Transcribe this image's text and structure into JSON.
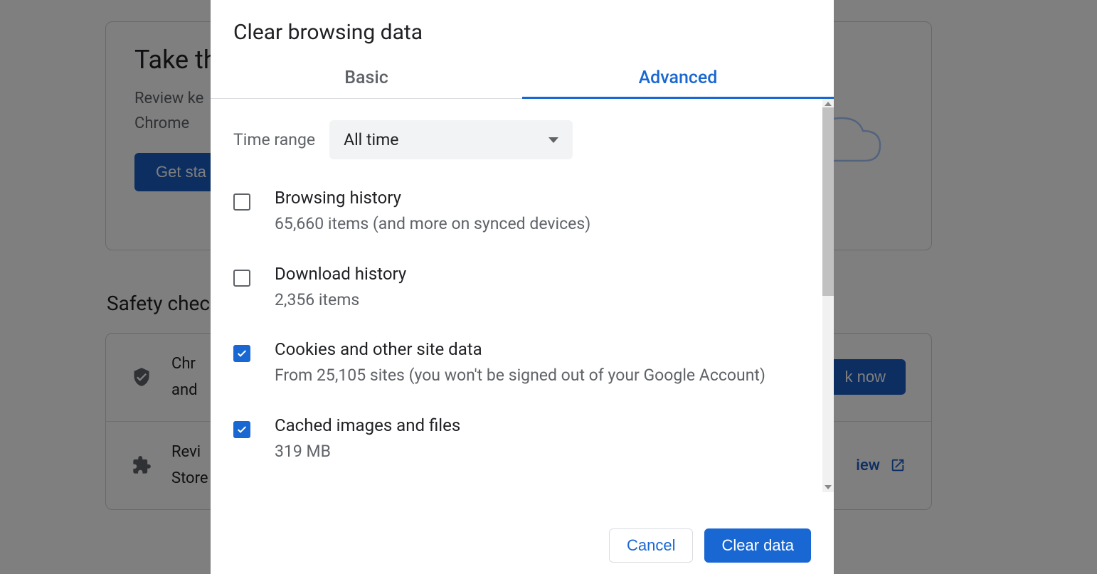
{
  "background": {
    "card1": {
      "title": "Take th",
      "text_line1": "Review ke",
      "text_line2": "Chrome",
      "button": "Get sta"
    },
    "heading2": "Safety chec",
    "row1": {
      "text_line1": "Chr",
      "text_line2": "and",
      "button": "k now"
    },
    "row2": {
      "text_line1": "Revi",
      "text_line2": "Store",
      "link": "iew"
    }
  },
  "modal": {
    "title": "Clear browsing data",
    "tabs": {
      "basic": "Basic",
      "advanced": "Advanced"
    },
    "time_range": {
      "label": "Time range",
      "value": "All time"
    },
    "options": {
      "browsing_history": {
        "title": "Browsing history",
        "sub": "65,660 items (and more on synced devices)",
        "checked": false
      },
      "download_history": {
        "title": "Download history",
        "sub": "2,356 items",
        "checked": false
      },
      "cookies": {
        "title": "Cookies and other site data",
        "sub": "From 25,105 sites (you won't be signed out of your Google Account)",
        "checked": true
      },
      "cached": {
        "title": "Cached images and files",
        "sub": "319 MB",
        "checked": true
      }
    },
    "buttons": {
      "cancel": "Cancel",
      "clear": "Clear data"
    }
  }
}
